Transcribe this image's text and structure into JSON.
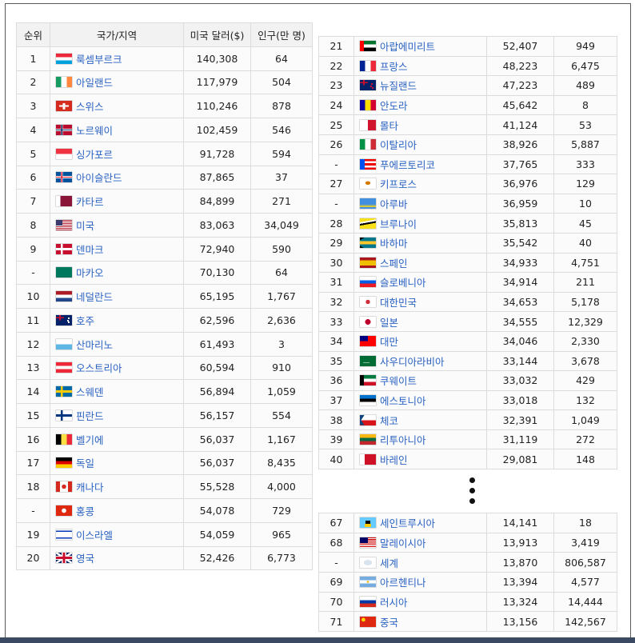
{
  "headers": {
    "rank": "순위",
    "country": "국가/지역",
    "gdp": "미국 달러($)",
    "pop": "인구(만 명)"
  },
  "table1": [
    {
      "rank": "1",
      "name": "룩셈부르크",
      "gdp": "140,308",
      "pop": "64",
      "flag": "lu"
    },
    {
      "rank": "2",
      "name": "아일랜드",
      "gdp": "117,979",
      "pop": "504",
      "flag": "ie"
    },
    {
      "rank": "3",
      "name": "스위스",
      "gdp": "110,246",
      "pop": "878",
      "flag": "ch"
    },
    {
      "rank": "4",
      "name": "노르웨이",
      "gdp": "102,459",
      "pop": "546",
      "flag": "no"
    },
    {
      "rank": "5",
      "name": "싱가포르",
      "gdp": "91,728",
      "pop": "594",
      "flag": "sg"
    },
    {
      "rank": "6",
      "name": "아이슬란드",
      "gdp": "87,865",
      "pop": "37",
      "flag": "is"
    },
    {
      "rank": "7",
      "name": "카타르",
      "gdp": "84,899",
      "pop": "271",
      "flag": "qa"
    },
    {
      "rank": "8",
      "name": "미국",
      "gdp": "83,063",
      "pop": "34,049",
      "flag": "us"
    },
    {
      "rank": "9",
      "name": "덴마크",
      "gdp": "72,940",
      "pop": "590",
      "flag": "dk"
    },
    {
      "rank": "-",
      "name": "마카오",
      "gdp": "70,130",
      "pop": "64",
      "flag": "mo"
    },
    {
      "rank": "10",
      "name": "네덜란드",
      "gdp": "65,195",
      "pop": "1,767",
      "flag": "nl"
    },
    {
      "rank": "11",
      "name": "호주",
      "gdp": "62,596",
      "pop": "2,636",
      "flag": "au"
    },
    {
      "rank": "12",
      "name": "산마리노",
      "gdp": "61,493",
      "pop": "3",
      "flag": "sm"
    },
    {
      "rank": "13",
      "name": "오스트리아",
      "gdp": "60,594",
      "pop": "910",
      "flag": "at"
    },
    {
      "rank": "14",
      "name": "스웨덴",
      "gdp": "56,894",
      "pop": "1,059",
      "flag": "se"
    },
    {
      "rank": "15",
      "name": "핀란드",
      "gdp": "56,157",
      "pop": "554",
      "flag": "fi"
    },
    {
      "rank": "16",
      "name": "벨기에",
      "gdp": "56,037",
      "pop": "1,167",
      "flag": "be"
    },
    {
      "rank": "17",
      "name": "독일",
      "gdp": "56,037",
      "pop": "8,435",
      "flag": "de"
    },
    {
      "rank": "18",
      "name": "캐나다",
      "gdp": "55,528",
      "pop": "4,000",
      "flag": "ca"
    },
    {
      "rank": "-",
      "name": "홍콩",
      "gdp": "54,078",
      "pop": "729",
      "flag": "hk"
    },
    {
      "rank": "19",
      "name": "이스라엘",
      "gdp": "54,059",
      "pop": "965",
      "flag": "il"
    },
    {
      "rank": "20",
      "name": "영국",
      "gdp": "52,426",
      "pop": "6,773",
      "flag": "gb"
    }
  ],
  "table2": [
    {
      "rank": "21",
      "name": "아랍에미리트",
      "gdp": "52,407",
      "pop": "949",
      "flag": "ae"
    },
    {
      "rank": "22",
      "name": "프랑스",
      "gdp": "48,223",
      "pop": "6,475",
      "flag": "fr"
    },
    {
      "rank": "23",
      "name": "뉴질랜드",
      "gdp": "47,223",
      "pop": "489",
      "flag": "nz"
    },
    {
      "rank": "24",
      "name": "안도라",
      "gdp": "45,642",
      "pop": "8",
      "flag": "ad"
    },
    {
      "rank": "25",
      "name": "몰타",
      "gdp": "41,124",
      "pop": "53",
      "flag": "mt"
    },
    {
      "rank": "26",
      "name": "이탈리아",
      "gdp": "38,926",
      "pop": "5,887",
      "flag": "it"
    },
    {
      "rank": "-",
      "name": "푸에르토리코",
      "gdp": "37,765",
      "pop": "333",
      "flag": "pr"
    },
    {
      "rank": "27",
      "name": "키프로스",
      "gdp": "36,976",
      "pop": "129",
      "flag": "cy"
    },
    {
      "rank": "-",
      "name": "아루바",
      "gdp": "36,959",
      "pop": "10",
      "flag": "aw"
    },
    {
      "rank": "28",
      "name": "브루나이",
      "gdp": "35,813",
      "pop": "45",
      "flag": "bn"
    },
    {
      "rank": "29",
      "name": "바하마",
      "gdp": "35,542",
      "pop": "40",
      "flag": "bs"
    },
    {
      "rank": "30",
      "name": "스페인",
      "gdp": "34,933",
      "pop": "4,751",
      "flag": "es"
    },
    {
      "rank": "31",
      "name": "슬로베니아",
      "gdp": "34,914",
      "pop": "211",
      "flag": "si"
    },
    {
      "rank": "32",
      "name": "대한민국",
      "gdp": "34,653",
      "pop": "5,178",
      "flag": "kr"
    },
    {
      "rank": "33",
      "name": "일본",
      "gdp": "34,555",
      "pop": "12,329",
      "flag": "jp"
    },
    {
      "rank": "34",
      "name": "대만",
      "gdp": "34,046",
      "pop": "2,330",
      "flag": "tw"
    },
    {
      "rank": "35",
      "name": "사우디아라비아",
      "gdp": "33,144",
      "pop": "3,678",
      "flag": "sa"
    },
    {
      "rank": "36",
      "name": "쿠웨이트",
      "gdp": "33,032",
      "pop": "429",
      "flag": "kw"
    },
    {
      "rank": "37",
      "name": "에스토니아",
      "gdp": "33,018",
      "pop": "132",
      "flag": "ee"
    },
    {
      "rank": "38",
      "name": "체코",
      "gdp": "32,391",
      "pop": "1,049",
      "flag": "cz"
    },
    {
      "rank": "39",
      "name": "리투아니아",
      "gdp": "31,119",
      "pop": "272",
      "flag": "lt"
    },
    {
      "rank": "40",
      "name": "바레인",
      "gdp": "29,081",
      "pop": "148",
      "flag": "bh"
    }
  ],
  "table3": [
    {
      "rank": "67",
      "name": "세인트루시아",
      "gdp": "14,141",
      "pop": "18",
      "flag": "lc"
    },
    {
      "rank": "68",
      "name": "말레이시아",
      "gdp": "13,913",
      "pop": "3,419",
      "flag": "my"
    },
    {
      "rank": "-",
      "name": "세계",
      "gdp": "13,870",
      "pop": "806,587",
      "flag": "un"
    },
    {
      "rank": "69",
      "name": "아르헨티나",
      "gdp": "13,394",
      "pop": "4,577",
      "flag": "ar"
    },
    {
      "rank": "70",
      "name": "러시아",
      "gdp": "13,324",
      "pop": "14,444",
      "flag": "ru"
    },
    {
      "rank": "71",
      "name": "중국",
      "gdp": "13,156",
      "pop": "142,567",
      "flag": "cn"
    }
  ],
  "colors": {
    "link": "#2a62c2",
    "header_bg": "#f2f2f2",
    "border": "#dcdcdc",
    "bottom_bar": "#3b4a62"
  }
}
